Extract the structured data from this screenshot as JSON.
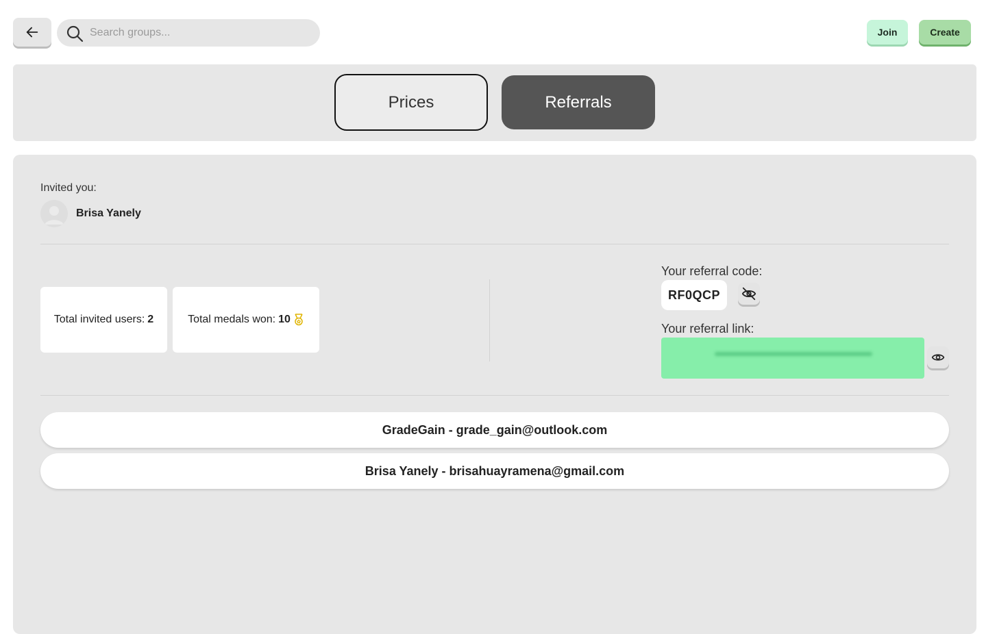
{
  "header": {
    "search_placeholder": "Search groups...",
    "join_label": "Join",
    "create_label": "Create"
  },
  "tabs": [
    {
      "label": "Prices",
      "active": false
    },
    {
      "label": "Referrals",
      "active": true
    }
  ],
  "inviter": {
    "label": "Invited you:",
    "name": "Brisa Yanely"
  },
  "stats": {
    "invited_label": "Total invited users:",
    "invited_value": "2",
    "medals_label": "Total medals won:",
    "medals_value": "10",
    "medal_icon": "medal-icon"
  },
  "referral": {
    "code_label": "Your referral code:",
    "code": "RF0QCP",
    "link_label": "Your referral link:",
    "link_hidden": true
  },
  "referred_users": [
    {
      "text": "GradeGain - grade_gain@outlook.com"
    },
    {
      "text": "Brisa Yanely - brisahuayramena@gmail.com"
    }
  ],
  "colors": {
    "active_tab": "#555555",
    "link_box": "#86eeaa",
    "join_bg": "#c6f5da",
    "create_bg": "#a8dca6",
    "medal": "#e0b400"
  }
}
